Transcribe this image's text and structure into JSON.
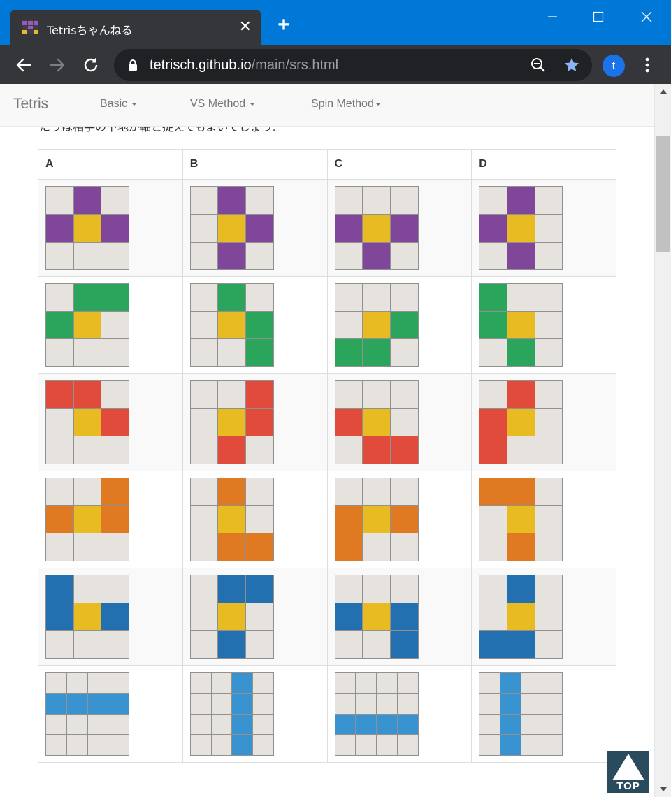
{
  "browser": {
    "tab_title": "Tetrisちゃんねる",
    "url_host": "tetrisch.github.io",
    "url_path": "/main/srs.html",
    "profile_initial": "t",
    "accent_color": "#0078d7"
  },
  "navbar": {
    "brand": "Tetris",
    "links": [
      "Basic",
      "VS Method",
      "Spin Method"
    ]
  },
  "intro_text_partial": "にうは相手の下地が軸と捉えてもよいでしょう.",
  "table": {
    "headers": [
      "A",
      "B",
      "C",
      "D"
    ],
    "rows": [
      {
        "piece": "T",
        "color": "#804699",
        "cells": [
          [
            "-X-",
            "XYX",
            "---"
          ],
          [
            "-X-",
            "-YX",
            "-X-"
          ],
          [
            "---",
            "XYX",
            "-X-"
          ],
          [
            "-X-",
            "XY-",
            "-X-"
          ]
        ]
      },
      {
        "piece": "S",
        "color": "#2ba55c",
        "cells": [
          [
            "-XX",
            "XY-",
            "---"
          ],
          [
            "-X-",
            "-YX",
            "--X"
          ],
          [
            "---",
            "-YX",
            "XX-"
          ],
          [
            "X--",
            "XY-",
            "-X-"
          ]
        ]
      },
      {
        "piece": "Z",
        "color": "#e04b3c",
        "cells": [
          [
            "XX-",
            "-YX",
            "---"
          ],
          [
            "--X",
            "-YX",
            "-X-"
          ],
          [
            "---",
            "XY-",
            "-XX"
          ],
          [
            "-X-",
            "XY-",
            "X--"
          ]
        ]
      },
      {
        "piece": "L",
        "color": "#e07a22",
        "cells": [
          [
            "--X",
            "XYX",
            "---"
          ],
          [
            "-X-",
            "-Y-",
            "-XX"
          ],
          [
            "---",
            "XYX",
            "X--"
          ],
          [
            "XX-",
            "-Y-",
            "-X-"
          ]
        ]
      },
      {
        "piece": "J",
        "color": "#2370b0",
        "cells": [
          [
            "X--",
            "XYX",
            "---"
          ],
          [
            "-XX",
            "-Y-",
            "-X-"
          ],
          [
            "---",
            "XYX",
            "--X"
          ],
          [
            "-X-",
            "-Y-",
            "XX-"
          ]
        ]
      },
      {
        "piece": "I",
        "color": "#3a93d1",
        "cells": [
          [
            "----",
            "XXXX",
            "----",
            "----"
          ],
          [
            "--X-",
            "--X-",
            "--X-",
            "--X-"
          ],
          [
            "----",
            "----",
            "XXXX",
            "----"
          ],
          [
            "-X--",
            "-X--",
            "-X--",
            "-X--"
          ]
        ]
      }
    ],
    "center_color": "#e8bb23",
    "empty_color": "#e6e3de"
  },
  "top_button_label": "TOP"
}
